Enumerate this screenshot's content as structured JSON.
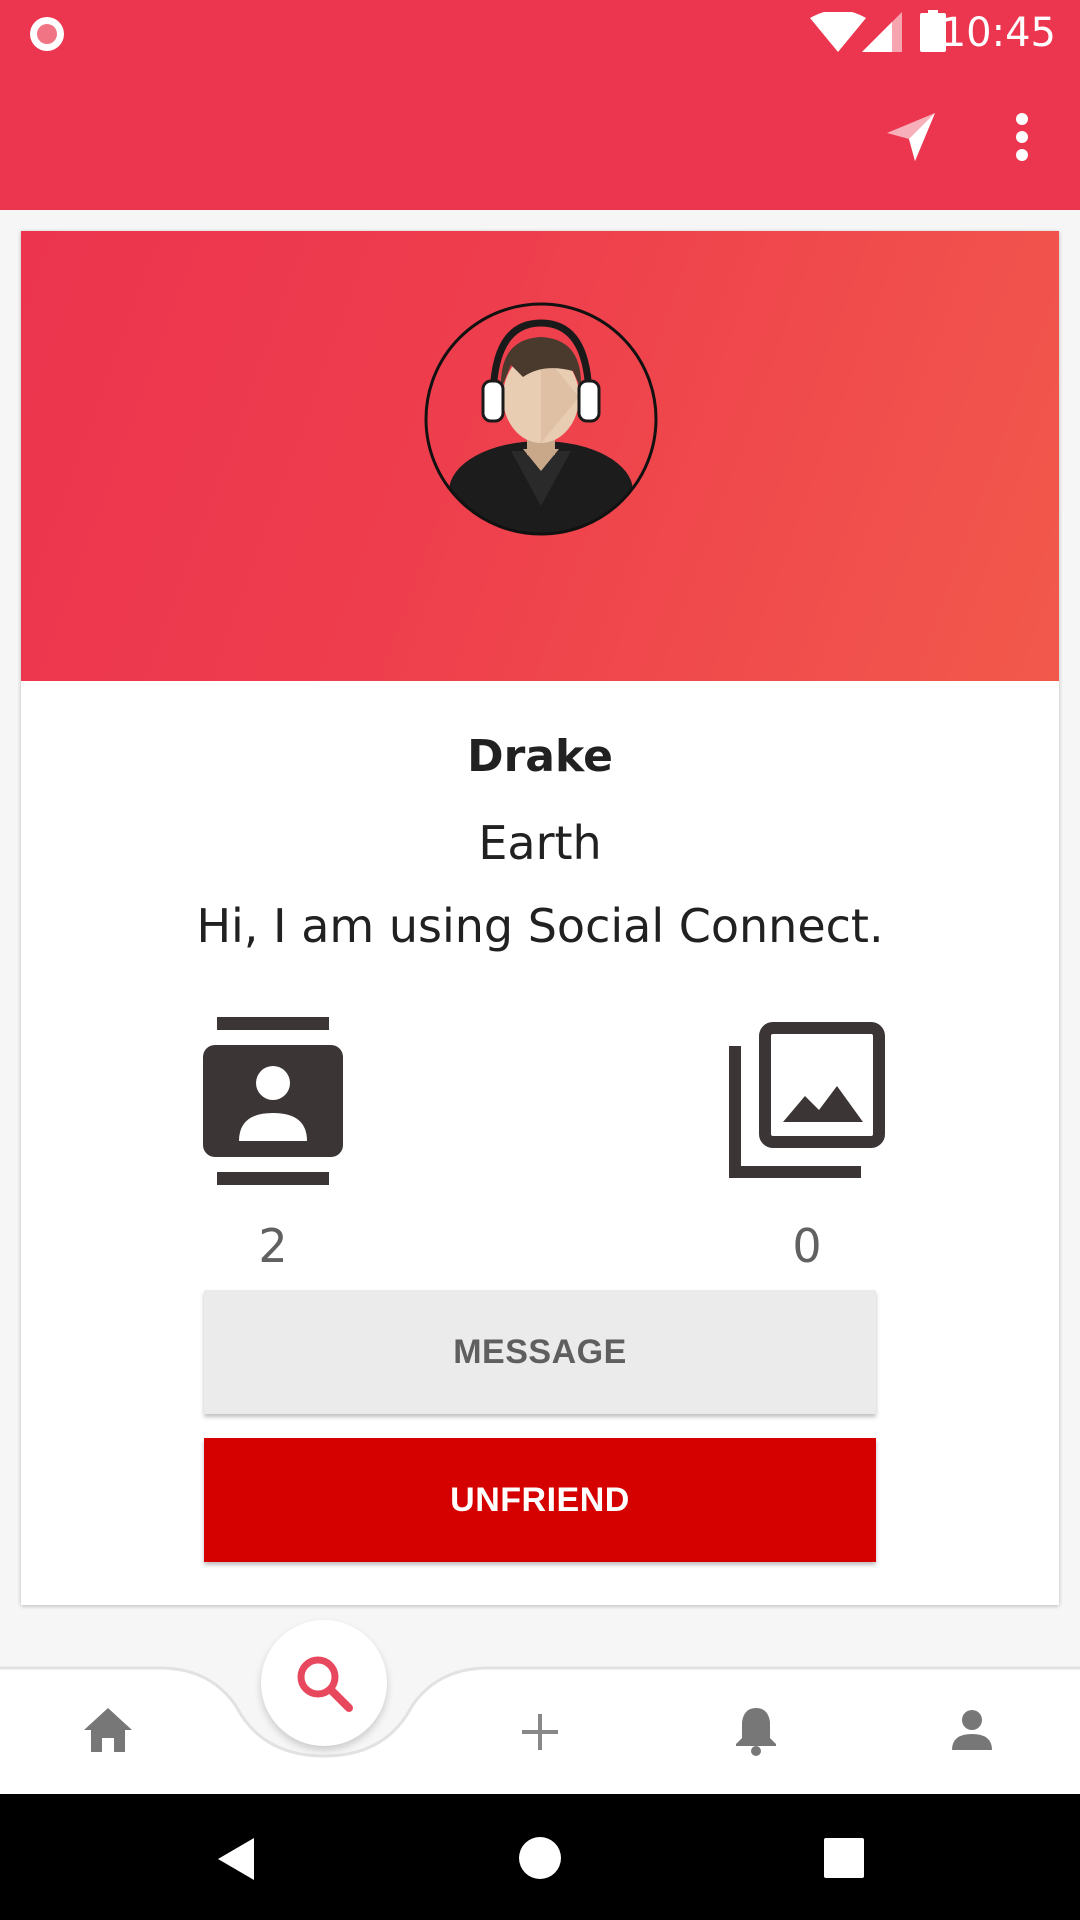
{
  "status_bar": {
    "time": "10:45"
  },
  "profile": {
    "name": "Drake",
    "location": "Earth",
    "bio": "Hi, I am using Social Connect."
  },
  "stats": {
    "friends_count": "2",
    "photos_count": "0"
  },
  "actions": {
    "message_label": "MESSAGE",
    "unfriend_label": "UNFRIEND"
  },
  "icons": {
    "appbar": [
      "send-icon",
      "more-vert-icon"
    ],
    "stats": [
      "contacts-icon",
      "photo-library-icon"
    ],
    "bottom_nav": [
      "home-icon",
      "search-icon",
      "add-icon",
      "bell-icon",
      "person-icon"
    ],
    "system_nav": [
      "back-icon",
      "home-circle-icon",
      "recents-icon"
    ]
  },
  "colors": {
    "primary": "#ec354e",
    "gradient_end": "#f2594b",
    "unfriend": "#d50000",
    "message_bg": "#ebebeb",
    "icon_dark": "#3b3535"
  }
}
